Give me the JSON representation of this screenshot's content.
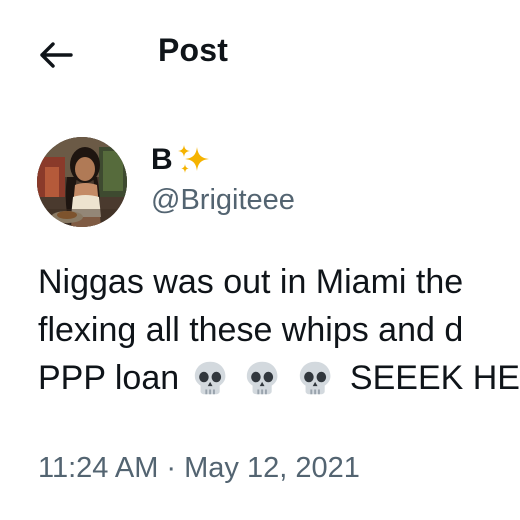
{
  "header": {
    "title": "Post"
  },
  "author": {
    "display_name": "B",
    "handle": "@Brigiteee"
  },
  "tweet": {
    "line1": "Niggas was out in Miami the",
    "line2": "flexing all these whips and d",
    "line3_prefix": "PPP loan",
    "line3_suffix": "SEEEK HE",
    "emojis": [
      "skull-icon",
      "skull-icon",
      "skull-icon"
    ]
  },
  "meta": {
    "timestamp": "11:24 AM · May 12, 2021"
  },
  "icons": {
    "back": "arrow-left-icon",
    "name_badge": "sparkles-icon"
  },
  "colors": {
    "text_primary": "#0f1419",
    "text_secondary": "#536471",
    "background": "#ffffff",
    "sparkle": "#f5b300"
  }
}
